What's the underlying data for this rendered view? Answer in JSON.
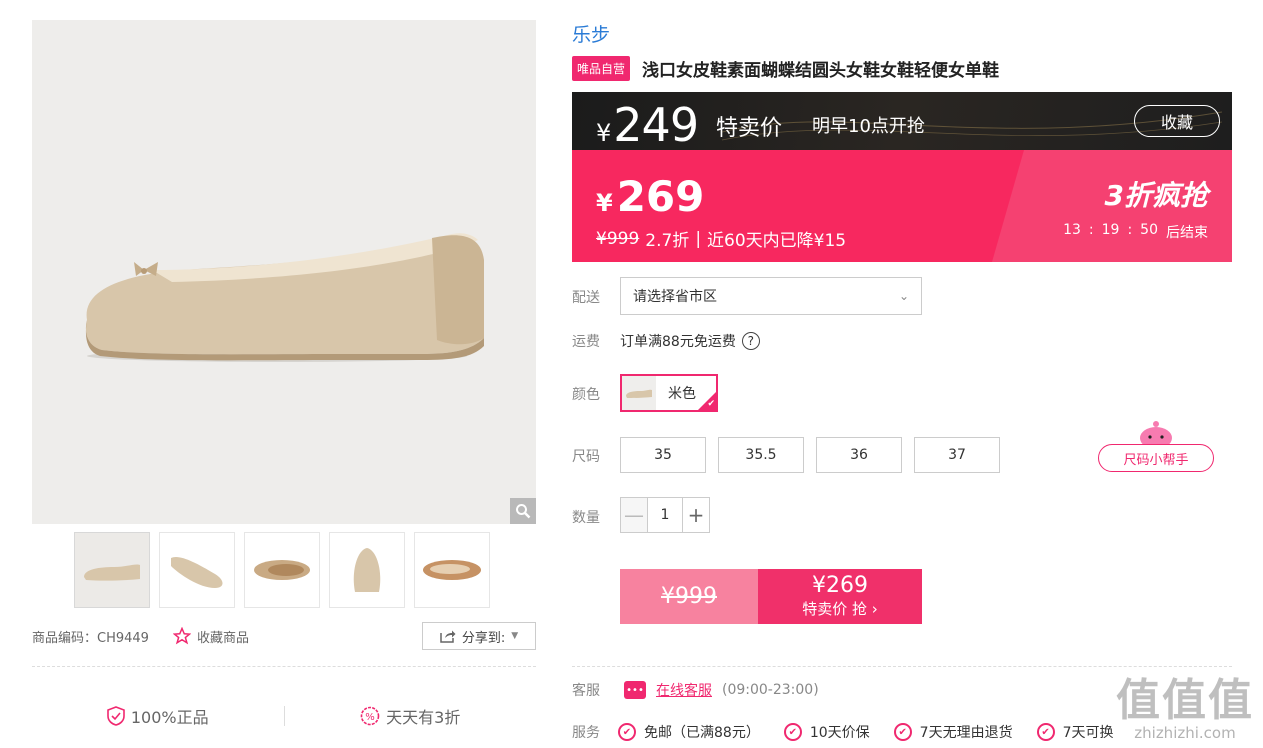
{
  "product": {
    "brand": "乐步",
    "self_badge": "唯品自营",
    "title": "浅口女皮鞋素面蝴蝶结圆头女鞋女鞋轻便女单鞋",
    "sku_label": "商品编码：CH9449",
    "fav_label": "收藏商品",
    "share_label": "分享到:"
  },
  "price_dark": {
    "yen": "¥",
    "price": "249",
    "special_label": "特卖价",
    "start_time": "明早10点开抢",
    "collect_label": "收藏"
  },
  "price_pink": {
    "yen": "¥",
    "price": "269",
    "original": "¥999",
    "discount": "2.7折",
    "separator": "|",
    "drop_note": "近60天内已降¥15",
    "promo": "3折疯抢",
    "countdown_h": "13",
    "countdown_m": "19",
    "countdown_s": "50",
    "colon": ":",
    "countdown_suffix": "后结束"
  },
  "options": {
    "delivery_label": "配送",
    "region_placeholder": "请选择省市区",
    "freight_label": "运费",
    "freight_text": "订单满88元免运费",
    "help_glyph": "?",
    "color_label": "颜色",
    "color_name": "米色",
    "size_label": "尺码",
    "sizes": [
      "35",
      "35.5",
      "36",
      "37"
    ],
    "size_helper": "尺码小帮手",
    "qty_label": "数量",
    "qty_value": "1",
    "minus": "—",
    "plus": "+"
  },
  "buy": {
    "orig_price": "¥999",
    "price": "¥269",
    "label": "特卖价 抢 ›"
  },
  "service": {
    "cs_label": "客服",
    "cs_link": "在线客服",
    "cs_hours": "(09:00-23:00)",
    "services_label": "服务",
    "items": [
      "免邮（已满88元）",
      "10天价保",
      "7天无理由退货",
      "7天可换"
    ]
  },
  "guarantees": [
    "100%正品",
    "天天有3折"
  ],
  "watermark": {
    "big": "值值值",
    "small": "zhizhizhi.com"
  },
  "colors": {
    "accent": "#f0286f",
    "pink_bg": "#f7285f",
    "link_blue": "#2a7bd6"
  }
}
